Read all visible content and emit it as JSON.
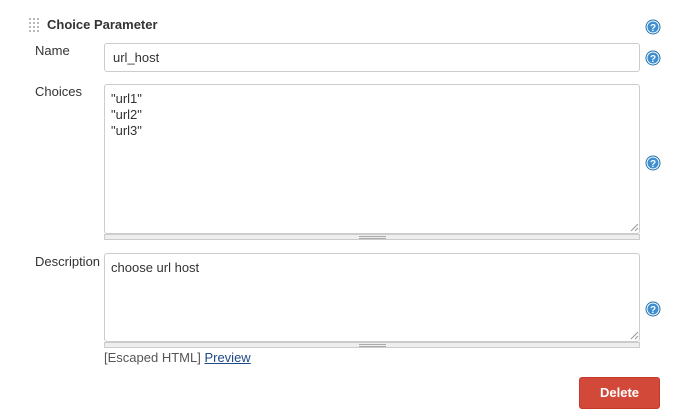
{
  "section": {
    "title": "Choice Parameter"
  },
  "fields": {
    "name": {
      "label": "Name",
      "value": "url_host"
    },
    "choices": {
      "label": "Choices",
      "value": "\"url1\"\n\"url2\"\n\"url3\""
    },
    "description": {
      "label": "Description",
      "value": "choose url host"
    }
  },
  "footnote": {
    "escaped_html": "[Escaped HTML]",
    "preview_link": "Preview"
  },
  "actions": {
    "delete_label": "Delete"
  },
  "colors": {
    "help_icon": "#1f6fa8",
    "delete_button": "#d24939"
  },
  "icons": {
    "drag_handle": "drag-handle-icon",
    "help": "help-icon"
  }
}
